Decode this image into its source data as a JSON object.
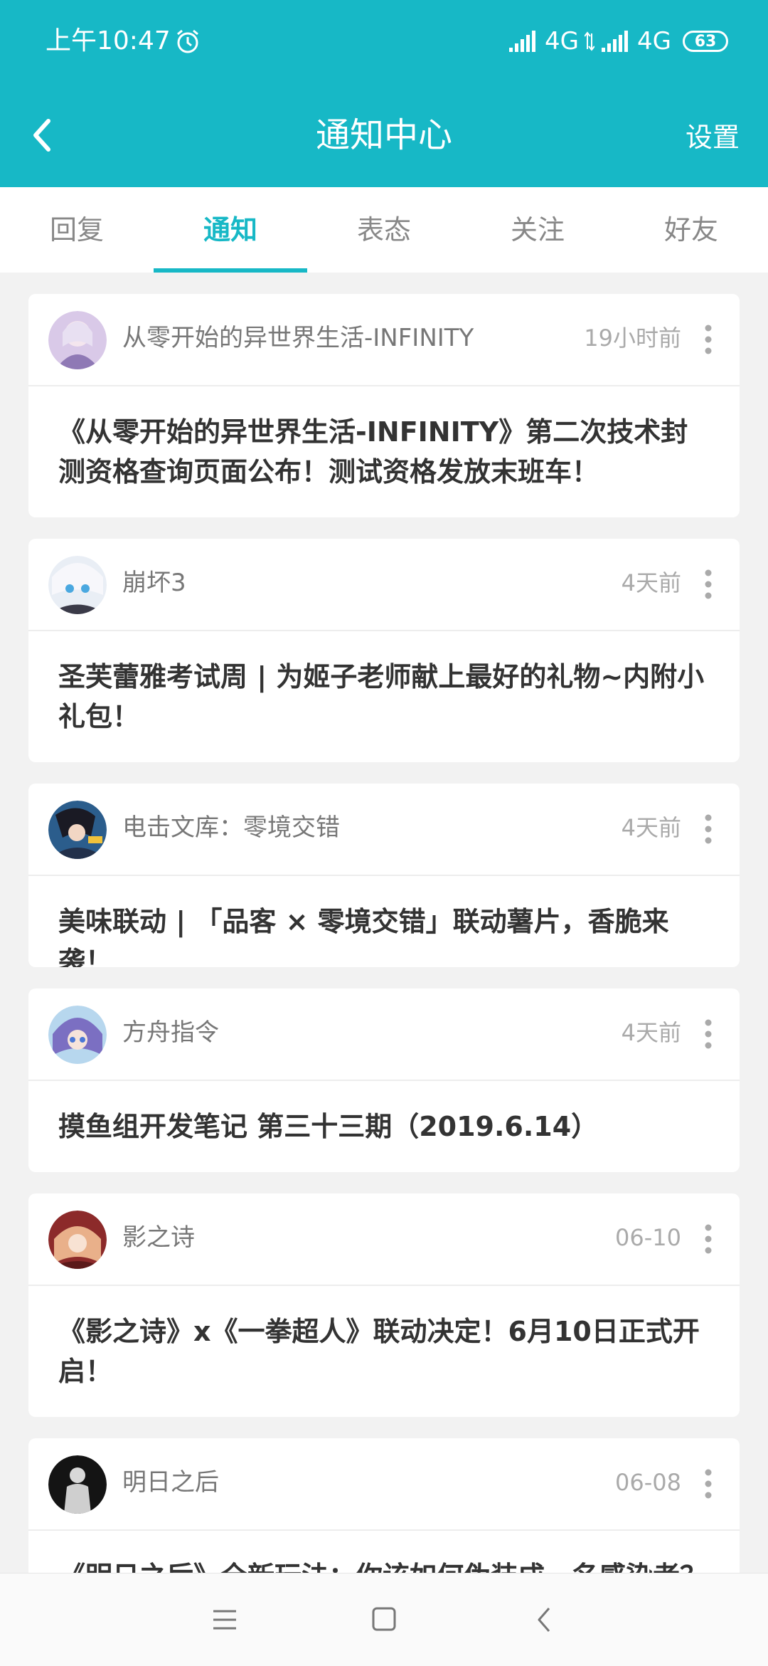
{
  "status_bar": {
    "time": "上午10:47",
    "network_1": "4G",
    "network_2": "4G",
    "battery": "63",
    "icons": [
      "alarm-icon",
      "signal-icon",
      "data-arrows-icon",
      "signal-icon",
      "battery-icon"
    ]
  },
  "nav": {
    "title": "通知中心",
    "settings_label": "设置",
    "back_icon": "chevron-left-icon"
  },
  "tabs": [
    {
      "label": "回复",
      "active": false
    },
    {
      "label": "通知",
      "active": true
    },
    {
      "label": "表态",
      "active": false
    },
    {
      "label": "关注",
      "active": false
    },
    {
      "label": "好友",
      "active": false
    }
  ],
  "notifications": [
    {
      "name": "从零开始的异世界生活-INFINITY",
      "time": "19小时前",
      "text": "《从零开始的异世界生活-INFINITY》第二次技术封测资格查询页面公布！测试资格发放末班车！"
    },
    {
      "name": "崩坏3",
      "time": "4天前",
      "text": "圣芙蕾雅考试周 | 为姬子老师献上最好的礼物~内附小礼包！"
    },
    {
      "name": "电击文库：零境交错",
      "time": "4天前",
      "text": "美味联动 | 「品客 × 零境交错」联动薯片，香脆来袭！"
    },
    {
      "name": "方舟指令",
      "time": "4天前",
      "text": "摸鱼组开发笔记 第三十三期（2019.6.14）"
    },
    {
      "name": "影之诗",
      "time": "06-10",
      "text": "《影之诗》x《一拳超人》联动决定！6月10日正式开启！"
    },
    {
      "name": "明日之后",
      "time": "06-08",
      "text": "《明日之后》全新玩法：你该如何伪装成一名感染者？"
    }
  ],
  "system_nav": {
    "menu_icon": "menu-icon",
    "home_icon": "home-square-icon",
    "back_icon": "back-triangle-icon"
  },
  "colors": {
    "accent": "#17b8c6",
    "background": "#f2f2f2",
    "card": "#ffffff"
  }
}
